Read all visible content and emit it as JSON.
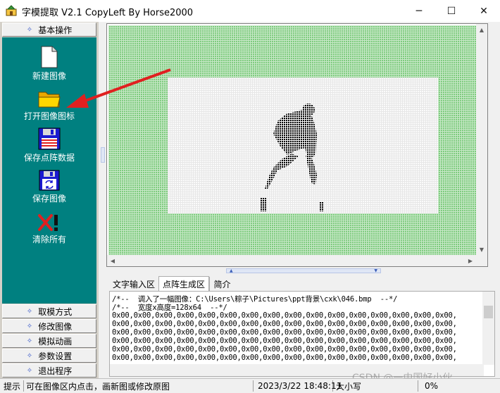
{
  "window": {
    "title": "字模提取 V2.1  CopyLeft By Horse2000",
    "minimize": "─",
    "maximize": "☐",
    "close": "✕"
  },
  "sidebar": {
    "top_button": "基本操作",
    "tools": [
      {
        "label": "新建图像",
        "icon": "new-image-icon"
      },
      {
        "label": "打开图像图标",
        "icon": "open-folder-icon"
      },
      {
        "label": "保存点阵数据",
        "icon": "save-matrix-icon"
      },
      {
        "label": "保存图像",
        "icon": "save-image-icon"
      },
      {
        "label": "清除所有",
        "icon": "clear-all-icon"
      }
    ],
    "bottom_buttons": [
      "取模方式",
      "修改图像",
      "模拟动画",
      "参数设置",
      "退出程序"
    ]
  },
  "tabs": [
    "文字输入区",
    "点阵生成区",
    "简介"
  ],
  "active_tab": "点阵生成区",
  "output": {
    "lines": [
      "/*--  调入了一幅图像：C:\\Users\\粽子\\Pictures\\ppt背景\\cxk\\046.bmp  --*/",
      "/*--  宽度x高度=128x64  --*/",
      "0x00,0x00,0x00,0x00,0x00,0x00,0x00,0x00,0x00,0x00,0x00,0x00,0x00,0x00,0x00,0x00,",
      "0x00,0x00,0x00,0x00,0x00,0x00,0x00,0x00,0x00,0x00,0x00,0x00,0x00,0x00,0x00,0x00,",
      "0x00,0x00,0x00,0x00,0x00,0x00,0x00,0x00,0x00,0x00,0x00,0x00,0x00,0x00,0x00,0x00,",
      "0x00,0x00,0x00,0x00,0x00,0x00,0x00,0x00,0x00,0x00,0x00,0x00,0x00,0x00,0x00,0x00,",
      "0x00,0x00,0x00,0x00,0x00,0x00,0x00,0x00,0x00,0x00,0x00,0x00,0x00,0x00,0x00,0x00,",
      "0x00,0x00,0x00,0x00,0x00,0x00,0x00,0x00,0x00,0x00,0x00,0x00,0x00,0x00,0x00,0x00,"
    ]
  },
  "statusbar": {
    "label": "提示",
    "message": "可在图像区内点击，画新图或修改原图",
    "datetime": "2023/3/22 18:48:11",
    "size_label": "大小写",
    "percent": "0%"
  },
  "watermark": "CSDN @一中国好小伙",
  "colors": {
    "teal_panel": "#008080",
    "grid_green": "#7ecb7e",
    "accent_blue": "#3354c8",
    "arrow_red": "#e02020"
  }
}
